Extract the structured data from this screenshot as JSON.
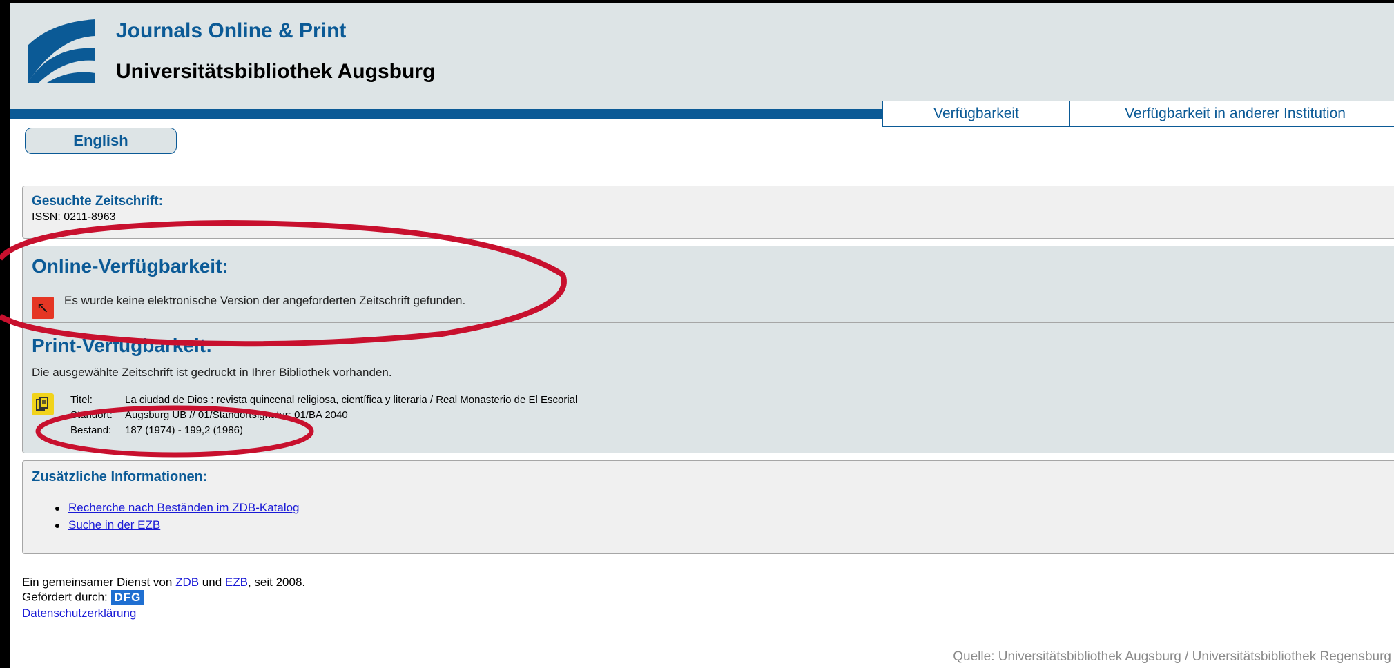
{
  "header": {
    "title": "Journals Online & Print",
    "subtitle": "Universitätsbibliothek Augsburg"
  },
  "tabs": [
    {
      "label": "Verfügbarkeit"
    },
    {
      "label": "Verfügbarkeit in anderer Institution"
    }
  ],
  "language_button": "English",
  "search": {
    "heading": "Gesuchte Zeitschrift:",
    "issn": "ISSN: 0211-8963"
  },
  "online": {
    "heading": "Online-Verfügbarkeit:",
    "message": "Es wurde keine elektronische Version der angeforderten Zeitschrift gefunden."
  },
  "print": {
    "heading": "Print-Verfügbarkeit:",
    "message": "Die ausgewählte Zeitschrift ist gedruckt in Ihrer Bibliothek vorhanden.",
    "rows": [
      {
        "label": "Titel:",
        "value": "La ciudad de Dios : revista quincenal religiosa, científica y literaria / Real Monasterio de El Escorial"
      },
      {
        "label": "Standort:",
        "value": "Augsburg UB // 01/Standortsignatur: 01/BA 2040"
      },
      {
        "label": "Bestand:",
        "value": "187 (1974) - 199,2 (1986)"
      }
    ]
  },
  "extra": {
    "heading": "Zusätzliche Informationen:",
    "links": [
      "Recherche nach Beständen im ZDB-Katalog",
      "Suche in der EZB"
    ]
  },
  "footer": {
    "service_prefix": "Ein gemeinsamer Dienst von",
    "zdb": "ZDB",
    "und": "und",
    "ezb": "EZB",
    "service_suffix": ", seit 2008.",
    "funded_by": "Gefördert durch:",
    "dfg_logo_text": "DFG",
    "privacy": "Datenschutzerklärung"
  },
  "source_credit": "Quelle: Universitätsbibliothek Augsburg / Universitätsbibliothek Regensburg",
  "colors": {
    "brand_blue": "#0b5a96",
    "header_bg": "#dde4e6",
    "annotation_red": "#c8102e",
    "error_icon": "#e53624",
    "print_icon": "#f1d31b",
    "link": "#1a1ad6"
  },
  "icons": {
    "logo": "uba-logo-icon",
    "online_status": "red-arrow-icon",
    "print_status": "document-icon"
  }
}
